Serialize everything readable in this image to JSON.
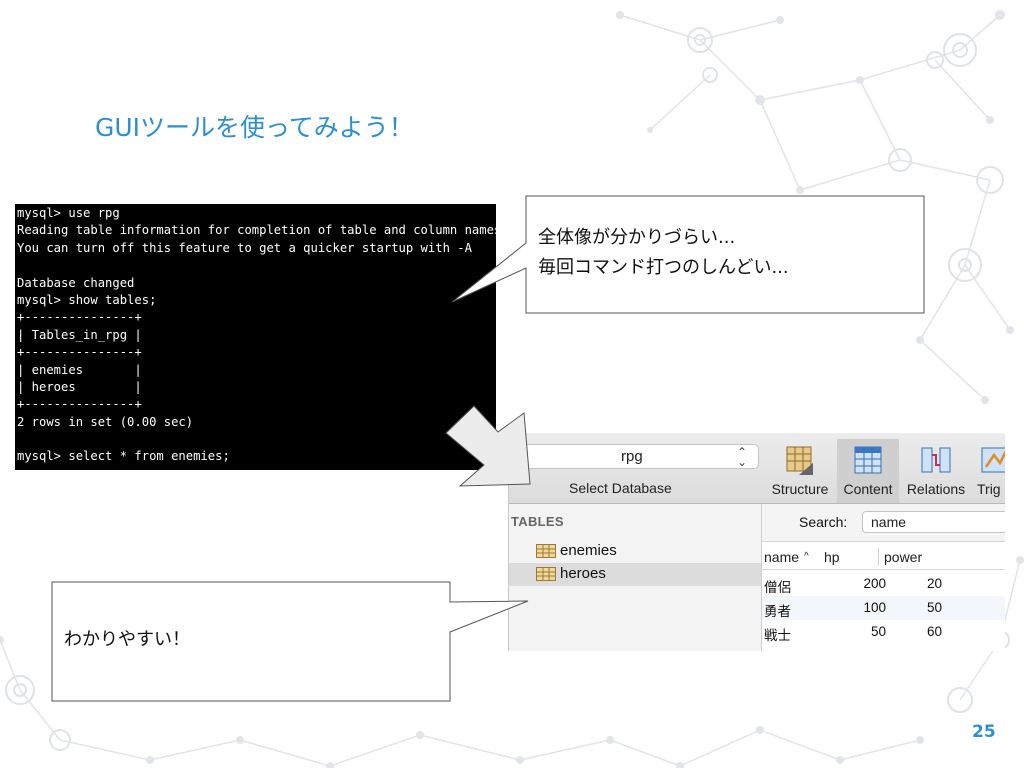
{
  "slide": {
    "title": "GUIツールを使ってみよう！",
    "page_number": "25"
  },
  "terminal": {
    "lines": [
      "mysql> use rpg",
      "Reading table information for completion of table and column names",
      "You can turn off this feature to get a quicker startup with -A",
      "",
      "Database changed",
      "mysql> show tables;",
      "+---------------+",
      "| Tables_in_rpg |",
      "+---------------+",
      "| enemies       |",
      "| heroes        |",
      "+---------------+",
      "2 rows in set (0.00 sec)",
      "",
      "mysql> select * from enemies;"
    ]
  },
  "callouts": {
    "top": {
      "line1": "全体像が分かりづらい...",
      "line2": "毎回コマンド打つのしんどい..."
    },
    "bottom": {
      "text": "わかりやすい！"
    }
  },
  "app": {
    "database_value": "rpg",
    "database_label": "Select Database",
    "toolbar": [
      {
        "label": "Structure",
        "icon": "structure-icon",
        "active": false
      },
      {
        "label": "Content",
        "icon": "content-icon",
        "active": true
      },
      {
        "label": "Relations",
        "icon": "relations-icon",
        "active": false
      },
      {
        "label": "Trig",
        "icon": "triggers-icon",
        "active": false
      }
    ],
    "sidebar": {
      "heading": "TABLES",
      "items": [
        {
          "label": "enemies",
          "selected": false
        },
        {
          "label": "heroes",
          "selected": true
        }
      ]
    },
    "search": {
      "label": "Search:",
      "value": "name"
    },
    "table": {
      "columns": [
        "name",
        "hp",
        "power"
      ],
      "rows": [
        [
          "僧侶",
          "200",
          "20"
        ],
        [
          "勇者",
          "100",
          "50"
        ],
        [
          "戦士",
          "50",
          "60"
        ]
      ]
    }
  },
  "colors": {
    "accent": "#2e8fd0",
    "decor": "#d9dde2"
  }
}
